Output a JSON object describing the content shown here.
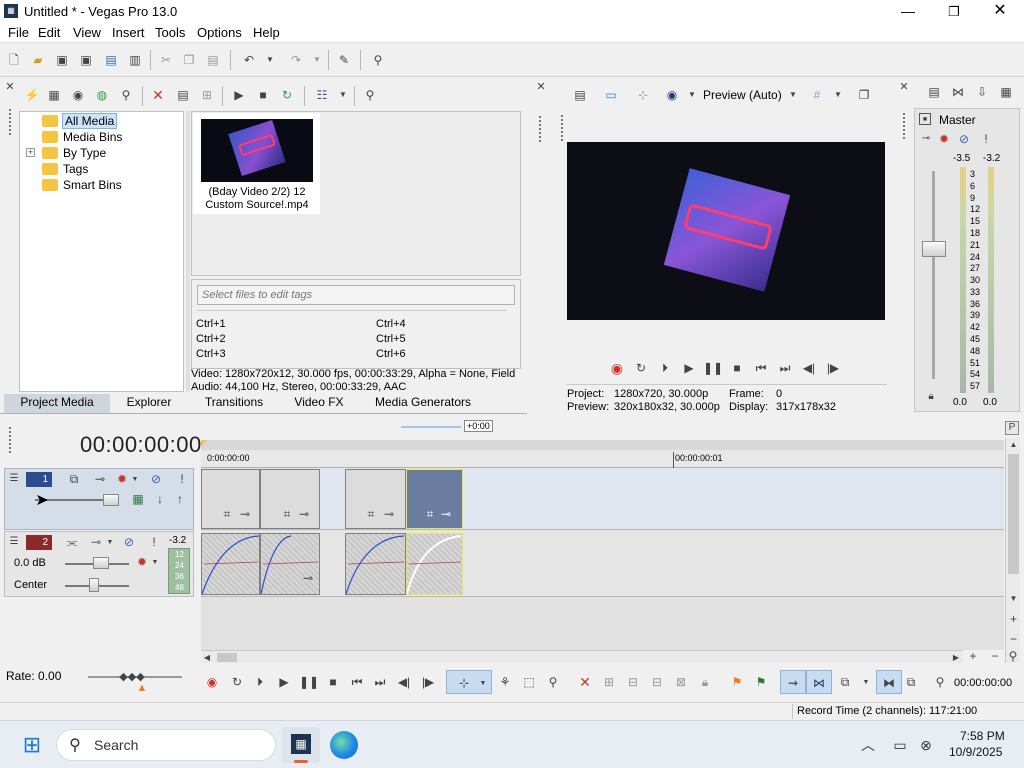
{
  "window": {
    "title": "Untitled * - Vegas Pro 13.0"
  },
  "menu": [
    "File",
    "Edit",
    "View",
    "Insert",
    "Tools",
    "Options",
    "Help"
  ],
  "media_tree": [
    "All Media",
    "Media Bins",
    "By Type",
    "Tags",
    "Smart Bins"
  ],
  "media_item": {
    "name": "(Bday Video 2/2) 12 Custom Source!.mp4"
  },
  "tags": {
    "placeholder": "Select files to edit tags",
    "shortcuts": [
      "Ctrl+1",
      "Ctrl+4",
      "Ctrl+2",
      "Ctrl+5",
      "Ctrl+3",
      "Ctrl+6"
    ]
  },
  "media_info": {
    "line1": "Video: 1280x720x12, 30.000 fps, 00:00:33:29, Alpha = None, Field",
    "line2": "Audio: 44,100 Hz, Stereo, 00:00:33:29, AAC"
  },
  "tabs": [
    "Project Media",
    "Explorer",
    "Transitions",
    "Video FX",
    "Media Generators"
  ],
  "preview": {
    "mode": "Preview (Auto)",
    "project_label": "Project:",
    "project_value": "1280x720, 30.000p",
    "preview_label": "Preview:",
    "preview_value": "320x180x32, 30.000p",
    "frame_label": "Frame:",
    "frame_value": "0",
    "display_label": "Display:",
    "display_value": "317x178x32"
  },
  "master": {
    "title": "Master",
    "peak_left": "-3.5",
    "peak_right": "-3.2",
    "scale": [
      "3",
      "6",
      "9",
      "12",
      "15",
      "18",
      "21",
      "24",
      "27",
      "30",
      "33",
      "36",
      "39",
      "42",
      "45",
      "48",
      "51",
      "54",
      "57"
    ],
    "fader_left": "0.0",
    "fader_right": "0.0"
  },
  "timeline": {
    "timecode": "00:00:00:00",
    "offset": "+0:00",
    "ruler": [
      "0:00:00:00",
      "00:00:00:01"
    ],
    "track1": {
      "number": "1"
    },
    "track2": {
      "number": "2",
      "volume": "0.0 dB",
      "pan": "Center",
      "peak": "-3.2",
      "meter": [
        "12",
        "24",
        "36",
        "48"
      ]
    },
    "rate": "Rate: 0.00",
    "end_timecode": "00:00:00:00",
    "record_time": "Record Time (2 channels): 117:21:00"
  },
  "taskbar": {
    "search": "Search",
    "time": "7:58 PM",
    "date": "10/9/2025"
  }
}
